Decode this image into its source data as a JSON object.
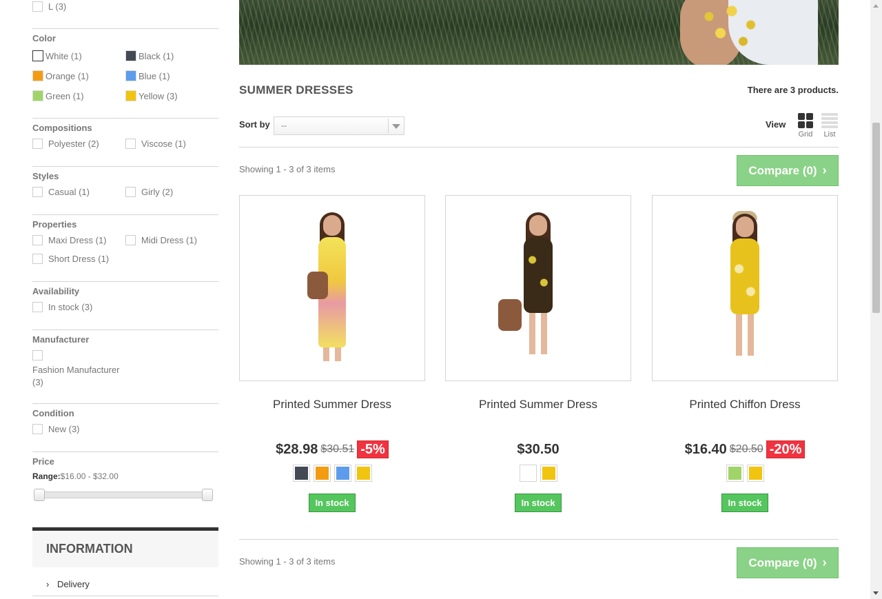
{
  "sidebar": {
    "size_l": "L (3)",
    "color_title": "Color",
    "colors": [
      {
        "label": "White (1)",
        "hex": "#ffffff"
      },
      {
        "label": "Black (1)",
        "hex": "#434a54"
      },
      {
        "label": "Orange (1)",
        "hex": "#f39c11"
      },
      {
        "label": "Blue (1)",
        "hex": "#5d9cec"
      },
      {
        "label": "Green (1)",
        "hex": "#a0d468"
      },
      {
        "label": "Yellow (3)",
        "hex": "#f1c40f"
      }
    ],
    "compositions_title": "Compositions",
    "compositions": [
      "Polyester (2)",
      "Viscose (1)"
    ],
    "styles_title": "Styles",
    "styles": [
      "Casual (1)",
      "Girly (2)"
    ],
    "properties_title": "Properties",
    "properties": [
      "Maxi Dress (1)",
      "Midi Dress (1)",
      "Short Dress (1)"
    ],
    "availability_title": "Availability",
    "availability": [
      "In stock (3)"
    ],
    "manufacturer_title": "Manufacturer",
    "manufacturer_line1": "Fashion Manufacturer",
    "manufacturer_line2": "(3)",
    "condition_title": "Condition",
    "condition": [
      "New (3)"
    ],
    "price_title": "Price",
    "price_range_label": "Range:",
    "price_range_value": " $16.00 - $32.00",
    "information_title": "INFORMATION",
    "information_items": [
      "Delivery"
    ]
  },
  "main": {
    "category_title": "SUMMER DRESSES",
    "product_count": "There are 3 products.",
    "sort_label": "Sort by",
    "sort_value": "--",
    "view_label": "View",
    "view_grid": "Grid",
    "view_list": "List",
    "showing": "Showing 1 - 3 of 3 items",
    "compare_label": "Compare (0)",
    "products": [
      {
        "name": "Printed Summer Dress",
        "price": "$28.98",
        "old_price": "$30.51",
        "reduction": "-5%",
        "colors": [
          "#434a54",
          "#f39c11",
          "#5d9cec",
          "#f1c40f"
        ],
        "stock": "In stock"
      },
      {
        "name": "Printed Summer Dress",
        "price": "$30.50",
        "old_price": "",
        "reduction": "",
        "colors": [
          "#ffffff",
          "#f1c40f"
        ],
        "stock": "In stock"
      },
      {
        "name": "Printed Chiffon Dress",
        "price": "$16.40",
        "old_price": "$20.50",
        "reduction": "-20%",
        "colors": [
          "#a0d468",
          "#f1c40f"
        ],
        "stock": "In stock"
      }
    ]
  },
  "colors": {
    "stock_green": "#55c65e",
    "reduction_red": "#f13340",
    "compare_green": "#8ad287"
  }
}
